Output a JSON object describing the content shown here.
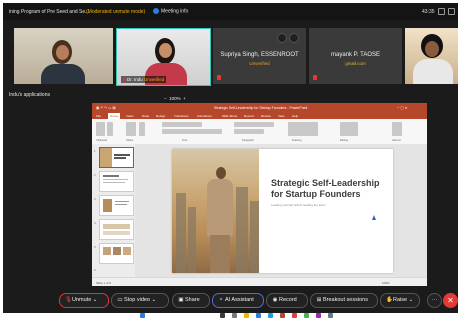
{
  "top_bar": {
    "meeting_title": "ining Program of Pre Seed and Se...",
    "moderated_label": "(Moderated unmute mode)",
    "info_label": "Meeting info",
    "clock": "43:35"
  },
  "participants": [
    {
      "name": "",
      "camera": true
    },
    {
      "name": "Dr. Indu",
      "status": "Unverified",
      "camera": true,
      "active": true
    },
    {
      "name": "Supriya Singh, ESSENROOT",
      "status": "Unverified",
      "camera": false
    },
    {
      "name": "mayank P. TAOSE",
      "status": "gmail.com",
      "camera": false
    },
    {
      "name": "",
      "camera": true
    }
  ],
  "shared_label": "Indu's applications",
  "powerpoint": {
    "window_title": "Strategic Self-Leadership for Startup Founders - PowerPoint",
    "tabs": [
      "File",
      "Home",
      "Insert",
      "Draw",
      "Design",
      "Transitions",
      "Animations",
      "Slide Show",
      "Record",
      "Review",
      "View",
      "Help"
    ],
    "active_tab": "Home",
    "ribbon_groups": [
      "Clipboard",
      "Slides",
      "Font",
      "Paragraph",
      "Drawing",
      "Editing",
      "Add-ins"
    ],
    "slide_count": 6,
    "slide_title": "Strategic Self-Leadership for Startup Founders",
    "slide_subtitle": "Leading yourself before leading the team",
    "status_left": "Slide 1 of 6",
    "zoom": "100%"
  },
  "controls": {
    "unmute": "Unmute",
    "stop_video": "Stop video",
    "share": "Share",
    "ai_assistant": "AI Assistant",
    "record": "Record",
    "breakout": "Breakout sessions",
    "raise": "Raise"
  },
  "colors": {
    "accent_teal": "#33c6b4",
    "ppt_red": "#b7472a",
    "end_red": "#e53935",
    "warning": "#f0b400"
  }
}
